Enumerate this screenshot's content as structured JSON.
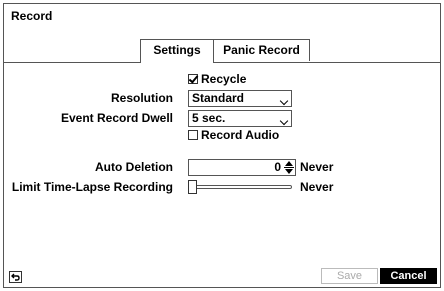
{
  "dialog": {
    "title": "Record"
  },
  "tabs": [
    {
      "label": "Settings",
      "active": true
    },
    {
      "label": "Panic Record",
      "active": false
    }
  ],
  "settings": {
    "recycle": {
      "label": "Recycle",
      "checked": true
    },
    "resolution": {
      "label": "Resolution",
      "value": "Standard"
    },
    "event_record_dwell": {
      "label": "Event Record Dwell",
      "value": "5 sec."
    },
    "record_audio": {
      "label": "Record Audio",
      "checked": false
    },
    "auto_deletion": {
      "label": "Auto Deletion",
      "value": "0",
      "unit_text": "Never"
    },
    "limit_time_lapse": {
      "label": "Limit Time-Lapse Recording",
      "value_text": "Never",
      "level": 0
    }
  },
  "footer": {
    "back_icon": "back-arrow-icon",
    "save_label": "Save",
    "cancel_label": "Cancel"
  },
  "colors": {
    "border": "#555555",
    "cancel_bg": "#000000",
    "disabled_text": "#aaaaaa"
  }
}
